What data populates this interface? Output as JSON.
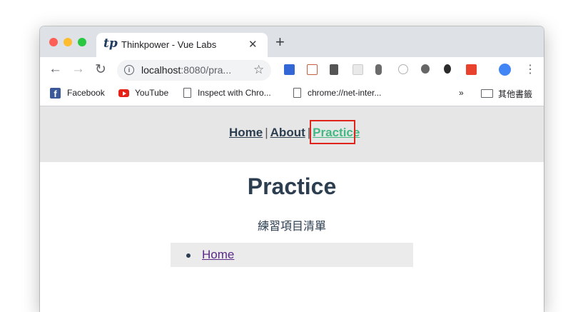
{
  "browser": {
    "tab_logo": "tp",
    "tab_title": "Thinkpower - Vue Labs",
    "tab_close": "✕",
    "new_tab": "+",
    "url_host": "localhost",
    "url_rest": ":8080/pra...",
    "bookmarks": {
      "facebook": "Facebook",
      "youtube": "YouTube",
      "inspect": "Inspect with Chro...",
      "net_internals": "chrome://net-inter...",
      "overflow": "»",
      "other_bookmarks": "其他書籤"
    }
  },
  "page": {
    "nav": {
      "home": "Home",
      "about": "About",
      "practice": "Practice",
      "separator": "|"
    },
    "title": "Practice",
    "subtitle": "練習項目清單",
    "list_items": [
      "Home"
    ]
  },
  "colors": {
    "accent": "#42b983",
    "text": "#2c3e50",
    "highlight": "#e0231b",
    "visited_link": "#5b2a86"
  }
}
